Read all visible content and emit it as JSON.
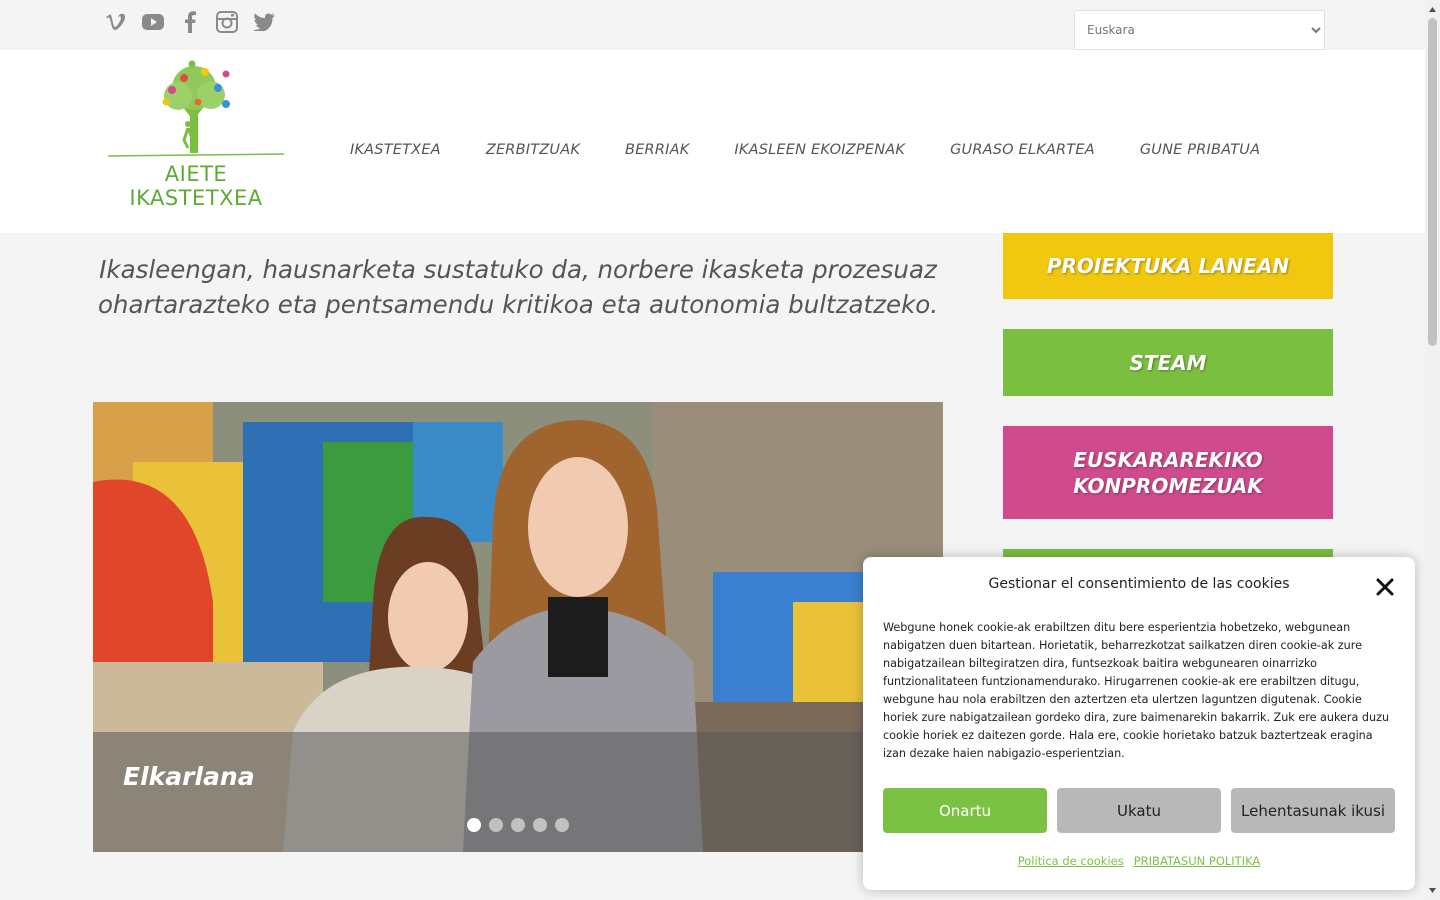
{
  "social": {
    "icons": [
      "vimeo-icon",
      "youtube-icon",
      "facebook-icon",
      "instagram-icon",
      "twitter-icon"
    ]
  },
  "language": {
    "selected": "Euskara"
  },
  "logo": {
    "text": "AIETE IKASTETXEA"
  },
  "nav": {
    "items": [
      "IKASTETXEA",
      "ZERBITZUAK",
      "BERRIAK",
      "IKASLEEN EKOIZPENAK",
      "GURASO ELKARTEA",
      "GUNE PRIBATUA"
    ]
  },
  "lead": {
    "line1": "Ikasleengan, hausnarketa sustatuko da, norbere ikasketa prozesuaz",
    "line2": "ohartarazteko eta pentsamendu kritikoa eta autonomia bultzatzeko."
  },
  "slider": {
    "caption": "Elkarlana",
    "slide_count": 5,
    "active_slide": 1
  },
  "sidebar": {
    "buttons": [
      {
        "label": "PROIEKTUKA LANEAN",
        "color": "#f2c70f"
      },
      {
        "label": "STEAM",
        "color": "#7bbf40"
      },
      {
        "label": "EUSKARAREKIKO KONPROMEZUAK",
        "color": "#cf4b8c"
      }
    ]
  },
  "cookie": {
    "title": "Gestionar el consentimiento de las cookies",
    "text": "Webgune honek cookie-ak erabiltzen ditu bere esperientzia hobetzeko, webgunean nabigatzen duen bitartean. Horietatik, beharrezkotzat sailkatzen diren cookie-ak zure nabigatzailean biltegiratzen dira, funtsezkoak baitira webgunearen oinarrizko funtzionalitateen funtzionamendurako. Hirugarrenen cookie-ak ere erabiltzen ditugu, webgune hau nola erabiltzen den aztertzen eta ulertzen laguntzen digutenak. Cookie horiek zure nabigatzailean gordeko dira, zure baimenarekin bakarrik. Zuk ere aukera duzu cookie horiek ez daitezen gorde. Hala ere, cookie horietako batzuk baztertzeak eragina izan dezake haien nabigazio-esperientzian.",
    "accept_label": "Onartu",
    "deny_label": "Ukatu",
    "prefs_label": "Lehentasunak ikusi",
    "link_cookies": "Política de cookies",
    "link_privacy": "PRIBATASUN POLITIKA",
    "accent": "#7bc143"
  }
}
